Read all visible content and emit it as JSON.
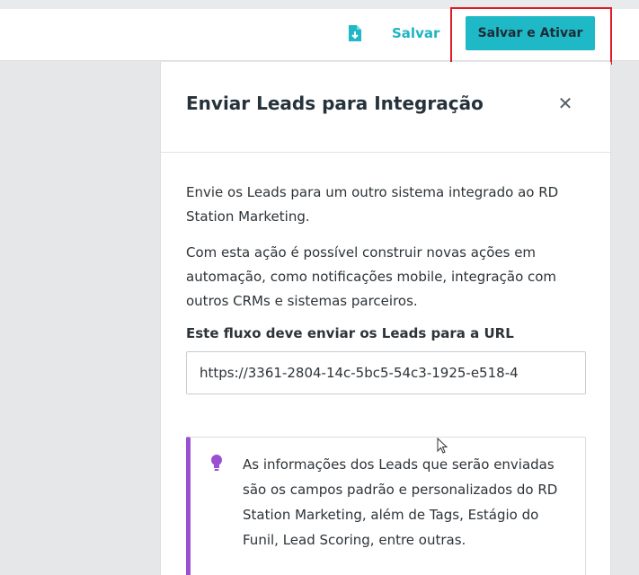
{
  "toolbar": {
    "export_icon": "file-download-icon",
    "save_label": "Salvar",
    "save_activate_label": "Salvar e Ativar"
  },
  "panel": {
    "title": "Enviar Leads para Integração",
    "close_icon": "close-icon",
    "paragraph_1": "Envie os Leads para um outro sistema integrado ao RD Station Marketing.",
    "paragraph_2": "Com esta ação é possível construir novas ações em automação, como notificações mobile, integração com outros CRMs e sistemas parceiros.",
    "url_label": "Este fluxo deve enviar os Leads para a URL",
    "url_value": "https://3361-2804-14c-5bc5-54c3-1925-e518-4",
    "info_icon": "lightbulb-icon",
    "info_text": "As informações dos Leads que serão enviadas são os campos padrão e personalizados do RD Station Marketing, além de Tags, Estágio do Funil, Lead Scoring, entre outras."
  },
  "colors": {
    "accent": "#1fb8c6",
    "highlight": "#e01b24",
    "info_bar": "#9b4fd1"
  }
}
